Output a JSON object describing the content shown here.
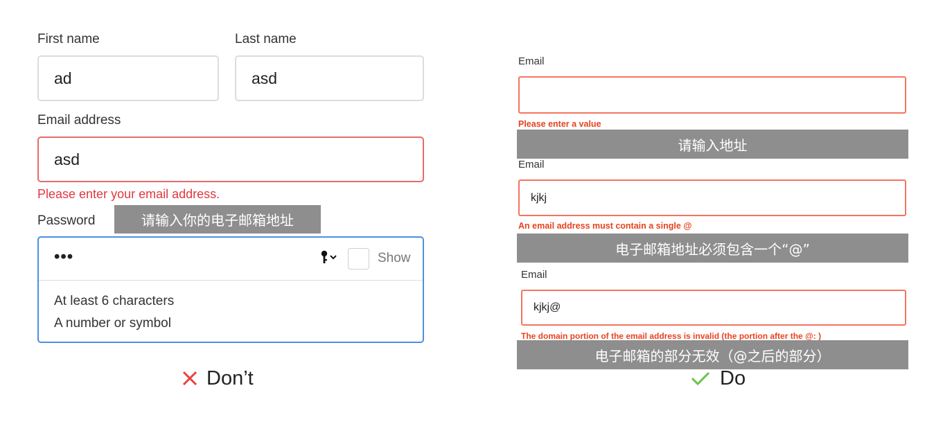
{
  "dont": {
    "first_name": {
      "label": "First name",
      "value": "ad"
    },
    "last_name": {
      "label": "Last name",
      "value": "asd"
    },
    "email": {
      "label": "Email address",
      "value": "asd",
      "error": "Please enter your email address."
    },
    "password": {
      "label": "Password",
      "value": "•••",
      "show_label": "Show",
      "hints": [
        "At least 6 characters",
        "A number or symbol"
      ]
    },
    "annotation": "请输入你的电子邮箱地址",
    "verdict": {
      "label": "Don’t",
      "icon": "close-icon",
      "color": "#e8413c"
    }
  },
  "do": {
    "fields": [
      {
        "label": "Email",
        "value": "",
        "error": "Please enter a value",
        "annotation": "请输入地址"
      },
      {
        "label": "Email",
        "value": "kjkj",
        "error": "An email address must contain a single @",
        "annotation": "电子邮箱地址必须包含一个“@”"
      },
      {
        "label": "Email",
        "value": "kjkj@",
        "error": "The domain portion of the email address is invalid (the portion after the @: )",
        "annotation": "电子邮箱的部分无效（@之后的部分）"
      }
    ],
    "verdict": {
      "label": "Do",
      "icon": "check-icon",
      "color": "#6cc24a"
    }
  }
}
